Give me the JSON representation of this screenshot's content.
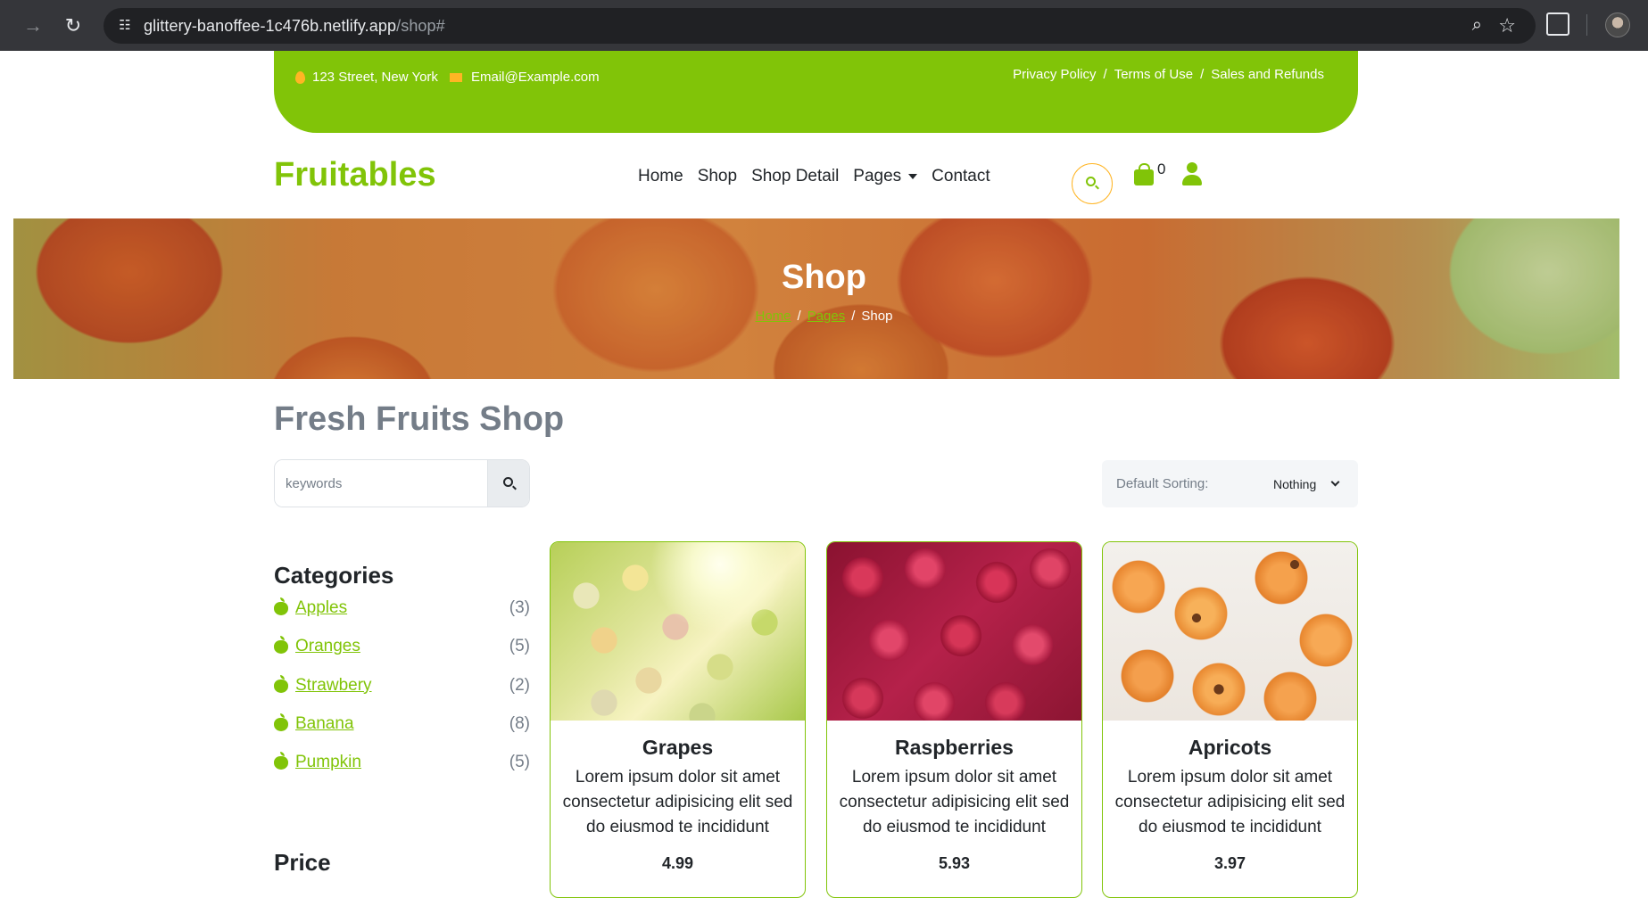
{
  "browser": {
    "url_host": "glittery-banoffee-1c476b.netlify.app",
    "url_path": "/shop#"
  },
  "topbar": {
    "address": "123 Street, New York",
    "email": "Email@Example.com",
    "links": [
      "Privacy Policy",
      "Terms of Use",
      "Sales and Refunds"
    ],
    "separator": "/"
  },
  "navbar": {
    "brand": "Fruitables",
    "items": [
      "Home",
      "Shop",
      "Shop Detail",
      "Pages",
      "Contact"
    ],
    "cart_count": "0"
  },
  "hero": {
    "title": "Shop",
    "breadcrumbs": [
      "Home",
      "Pages",
      "Shop"
    ],
    "separator": "/"
  },
  "main": {
    "title": "Fresh Fruits Shop",
    "search_placeholder": "keywords",
    "sorting_label": "Default Sorting:",
    "sorting_value": "Nothing"
  },
  "sidebar": {
    "categories_title": "Categories",
    "categories": [
      {
        "name": "Apples",
        "count": "(3)"
      },
      {
        "name": "Oranges",
        "count": "(5)"
      },
      {
        "name": "Strawbery",
        "count": "(2)"
      },
      {
        "name": "Banana",
        "count": "(8)"
      },
      {
        "name": "Pumpkin",
        "count": "(5)"
      }
    ],
    "price_title": "Price"
  },
  "products": [
    {
      "name": "Grapes",
      "description": "Lorem ipsum dolor sit amet consectetur adipisicing elit sed do eiusmod te incididunt",
      "price": "4.99"
    },
    {
      "name": "Raspberries",
      "description": "Lorem ipsum dolor sit amet consectetur adipisicing elit sed do eiusmod te incididunt",
      "price": "5.93"
    },
    {
      "name": "Apricots",
      "description": "Lorem ipsum dolor sit amet consectetur adipisicing elit sed do eiusmod te incididunt",
      "price": "3.97"
    }
  ],
  "colors": {
    "primary": "#81c408",
    "secondary": "#ffb524",
    "text_muted": "#747d88"
  }
}
